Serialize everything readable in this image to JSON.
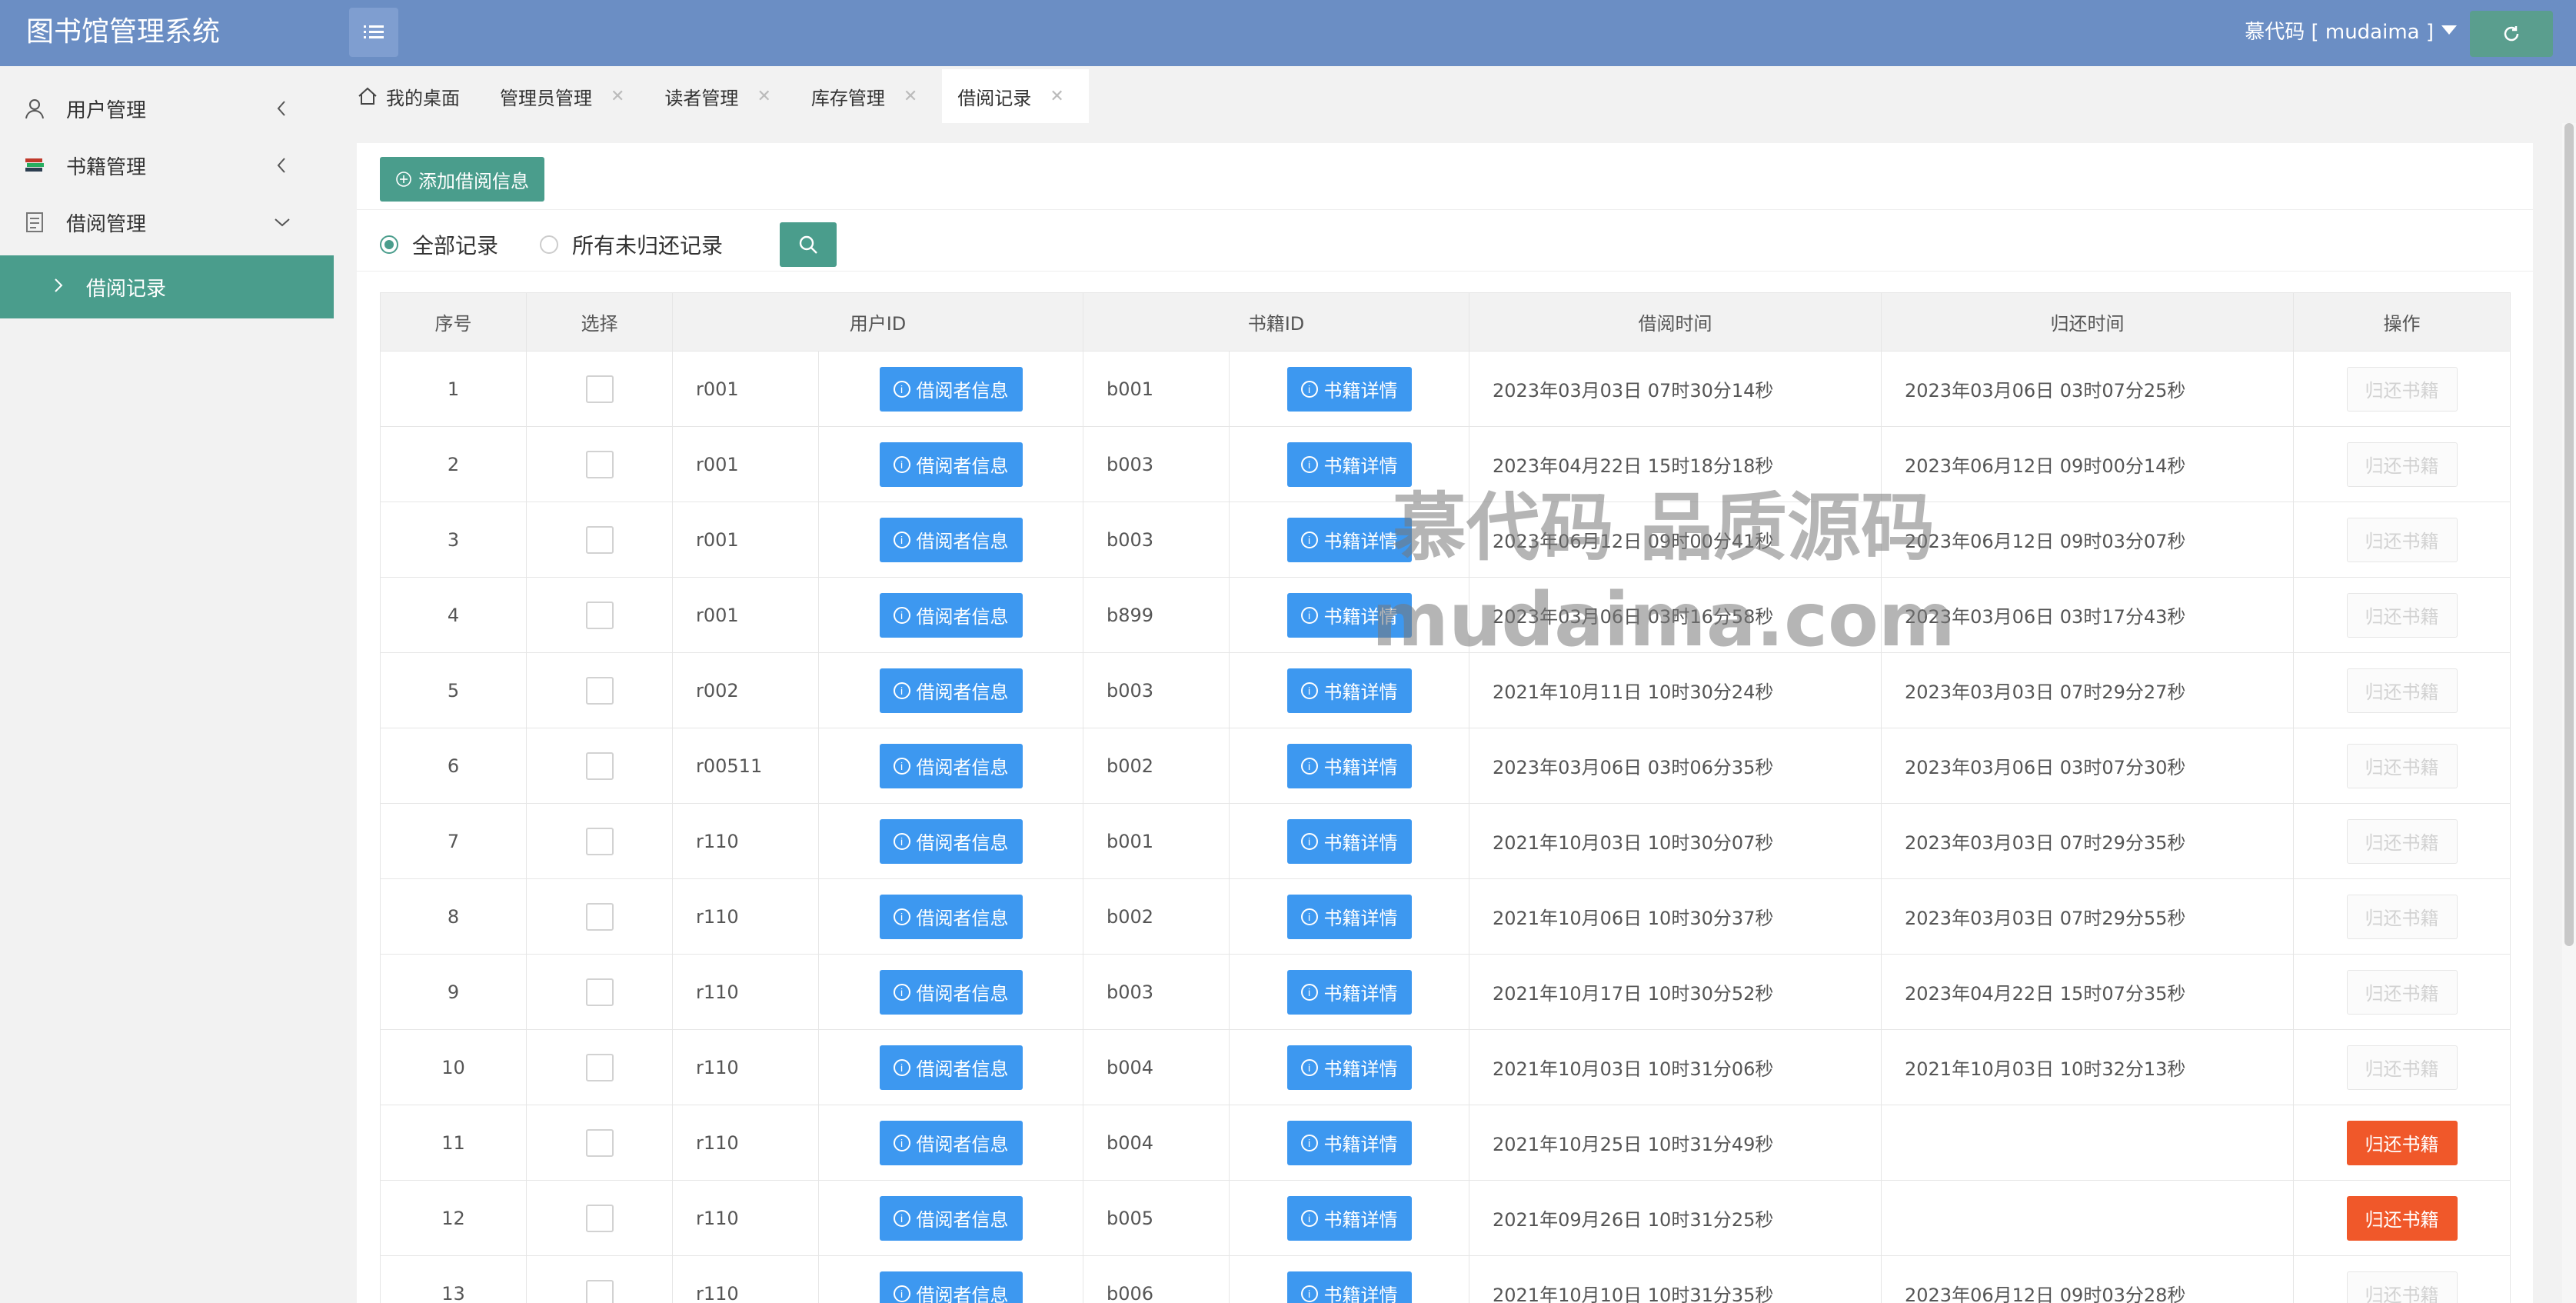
{
  "app": {
    "title": "图书馆管理系统"
  },
  "header": {
    "user_label": "慕代码 [ mudaima ]"
  },
  "sidebar": {
    "items": [
      {
        "label": "用户管理"
      },
      {
        "label": "书籍管理"
      },
      {
        "label": "借阅管理"
      }
    ],
    "sub_item": {
      "label": "借阅记录"
    }
  },
  "tabs": [
    {
      "label": "我的桌面"
    },
    {
      "label": "管理员管理"
    },
    {
      "label": "读者管理"
    },
    {
      "label": "库存管理"
    },
    {
      "label": "借阅记录"
    }
  ],
  "toolbar": {
    "add_label": "添加借阅信息"
  },
  "filters": {
    "all_label": "全部记录",
    "unreturned_label": "所有未归还记录"
  },
  "table": {
    "headers": [
      "序号",
      "选择",
      "用户ID",
      "书籍ID",
      "借阅时间",
      "归还时间",
      "操作"
    ],
    "reader_btn_label": "借阅者信息",
    "book_btn_label": "书籍详情",
    "return_btn_label": "归还书籍",
    "rows": [
      {
        "no": "1",
        "user": "r001",
        "book": "b001",
        "borrow": "2023年03月03日 07时30分14秒",
        "return": "2023年03月06日 03时07分25秒"
      },
      {
        "no": "2",
        "user": "r001",
        "book": "b003",
        "borrow": "2023年04月22日 15时18分18秒",
        "return": "2023年06月12日 09时00分14秒"
      },
      {
        "no": "3",
        "user": "r001",
        "book": "b003",
        "borrow": "2023年06月12日 09时00分41秒",
        "return": "2023年06月12日 09时03分07秒"
      },
      {
        "no": "4",
        "user": "r001",
        "book": "b899",
        "borrow": "2023年03月06日 03时16分58秒",
        "return": "2023年03月06日 03时17分43秒"
      },
      {
        "no": "5",
        "user": "r002",
        "book": "b003",
        "borrow": "2021年10月11日 10时30分24秒",
        "return": "2023年03月03日 07时29分27秒"
      },
      {
        "no": "6",
        "user": "r00511",
        "book": "b002",
        "borrow": "2023年03月06日 03时06分35秒",
        "return": "2023年03月06日 03时07分30秒"
      },
      {
        "no": "7",
        "user": "r110",
        "book": "b001",
        "borrow": "2021年10月03日 10时30分07秒",
        "return": "2023年03月03日 07时29分35秒"
      },
      {
        "no": "8",
        "user": "r110",
        "book": "b002",
        "borrow": "2021年10月06日 10时30分37秒",
        "return": "2023年03月03日 07时29分55秒"
      },
      {
        "no": "9",
        "user": "r110",
        "book": "b003",
        "borrow": "2021年10月17日 10时30分52秒",
        "return": "2023年04月22日 15时07分35秒"
      },
      {
        "no": "10",
        "user": "r110",
        "book": "b004",
        "borrow": "2021年10月03日 10时31分06秒",
        "return": "2021年10月03日 10时32分13秒"
      },
      {
        "no": "11",
        "user": "r110",
        "book": "b004",
        "borrow": "2021年10月25日 10时31分49秒",
        "return": ""
      },
      {
        "no": "12",
        "user": "r110",
        "book": "b005",
        "borrow": "2021年09月26日 10时31分25秒",
        "return": ""
      },
      {
        "no": "13",
        "user": "r110",
        "book": "b006",
        "borrow": "2021年10月10日 10时31分35秒",
        "return": "2023年06月12日 09时03分28秒"
      }
    ]
  },
  "watermark": {
    "line1": "慕代码 品质源码",
    "line2": "mudaima.com"
  },
  "colors": {
    "header": "#6b8ec4",
    "accent": "#4a9d8c",
    "button_blue": "#3d98f0",
    "return_active": "#f0582a"
  }
}
